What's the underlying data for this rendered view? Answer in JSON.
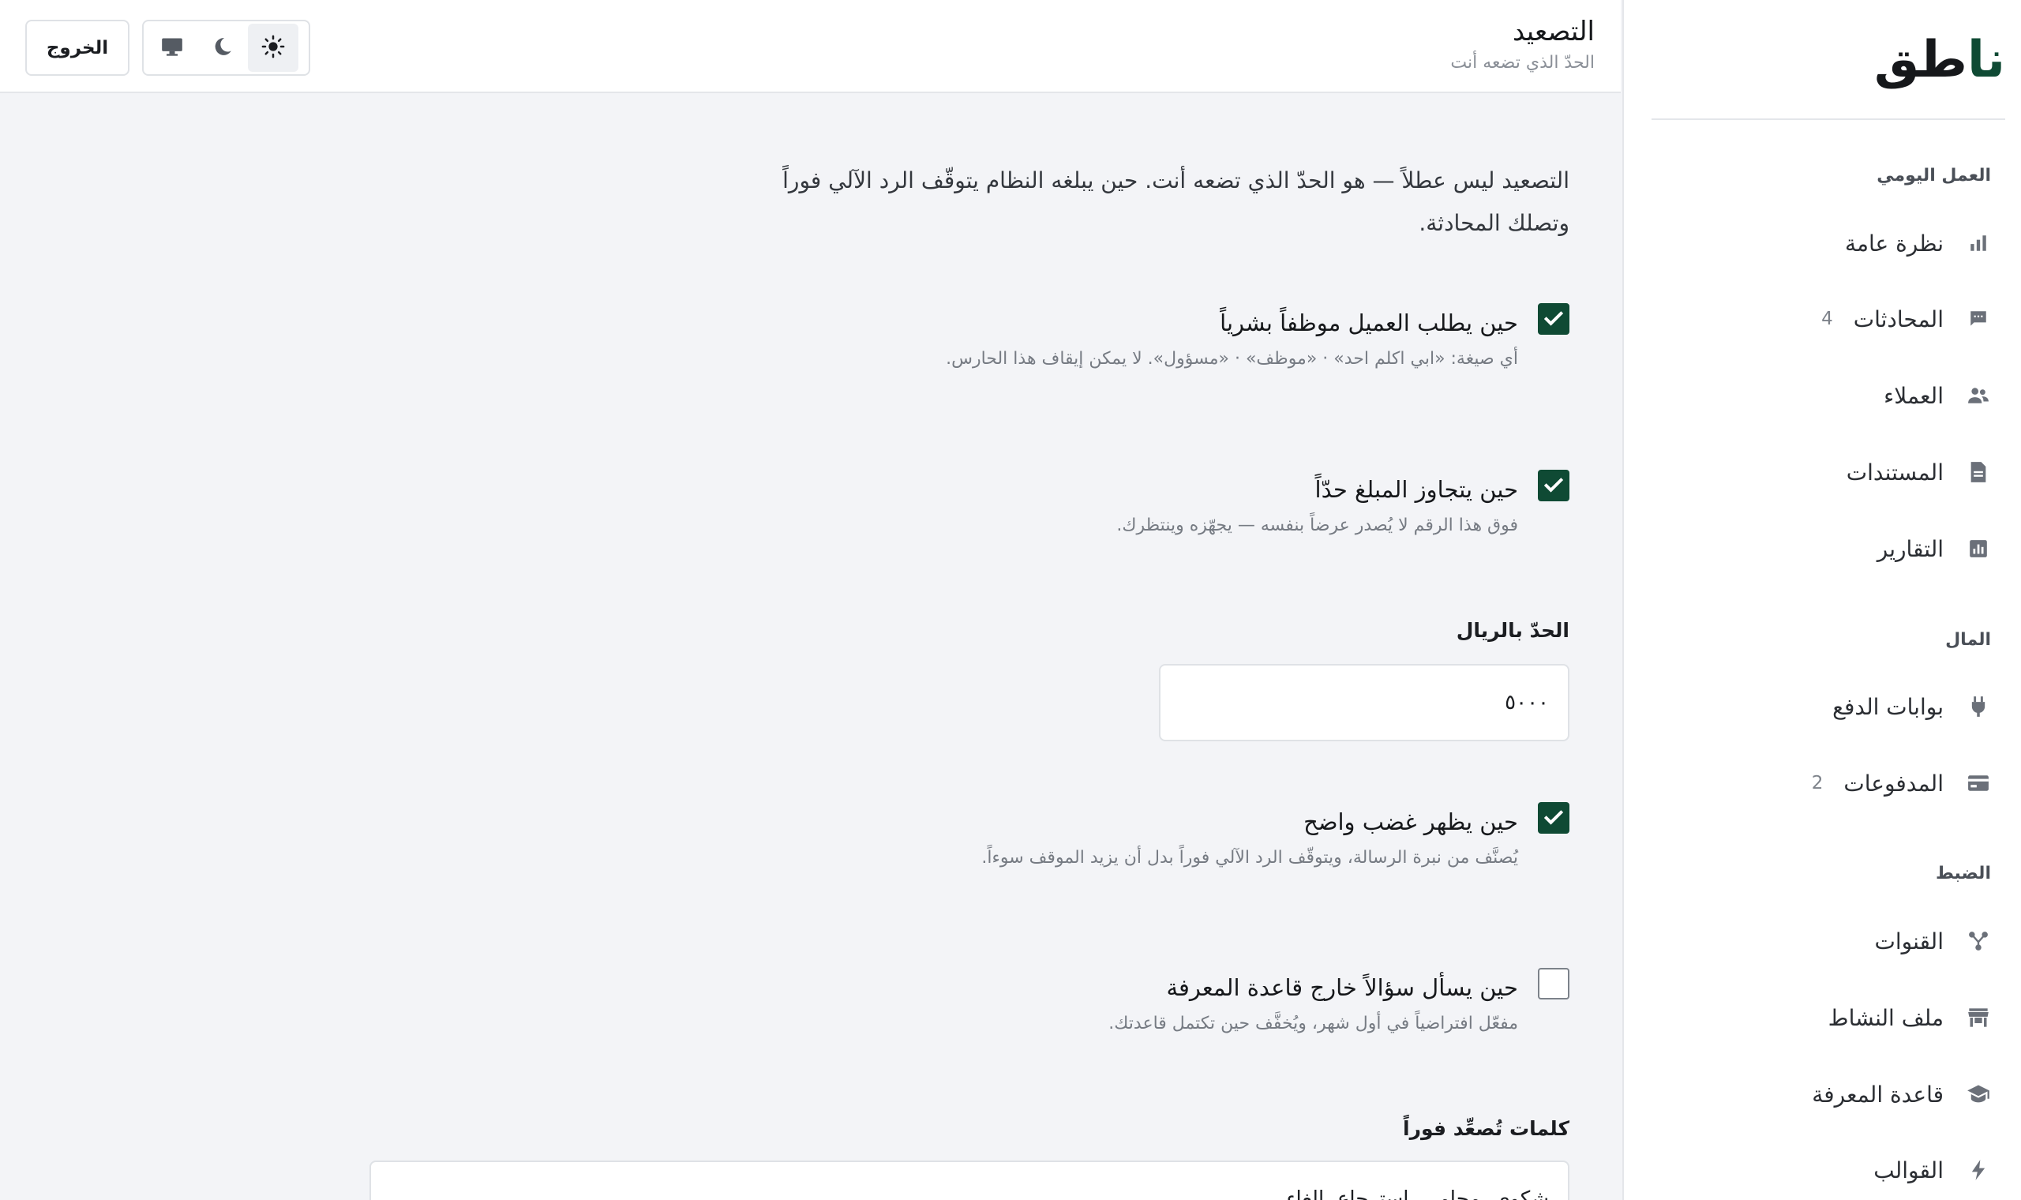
{
  "sidebar": {
    "brand_part1": "نا",
    "brand_part2": "طق",
    "sections": [
      {
        "label": "العمل اليومي"
      },
      {
        "label": "المال"
      },
      {
        "label": "الضبط"
      }
    ],
    "items": [
      {
        "label": "نظرة عامة",
        "icon": "bar-chart-icon",
        "count": ""
      },
      {
        "label": "المحادثات",
        "icon": "chat-icon",
        "count": "4"
      },
      {
        "label": "العملاء",
        "icon": "people-icon",
        "count": ""
      },
      {
        "label": "المستندات",
        "icon": "document-icon",
        "count": ""
      },
      {
        "label": "التقارير",
        "icon": "report-icon",
        "count": ""
      },
      {
        "label": "بوابات الدفع",
        "icon": "plug-icon",
        "count": ""
      },
      {
        "label": "المدفوعات",
        "icon": "credit-card-icon",
        "count": "2"
      },
      {
        "label": "القنوات",
        "icon": "channels-icon",
        "count": ""
      },
      {
        "label": "ملف النشاط",
        "icon": "store-icon",
        "count": ""
      },
      {
        "label": "قاعدة المعرفة",
        "icon": "graduation-cap-icon",
        "count": ""
      },
      {
        "label": "القوالب",
        "icon": "lightning-icon",
        "count": ""
      }
    ]
  },
  "header": {
    "title": "التصعيد",
    "subtitle": "الحدّ الذي تضعه أنت",
    "theme_options": [
      "light-mode-icon",
      "dark-mode-icon",
      "system-mode-icon"
    ],
    "theme_selected": "light",
    "logout_label": "الخروج"
  },
  "main": {
    "intro_line1": "التصعيد ليس عطلاً — هو الحدّ الذي تضعه أنت. حين يبلغه النظام يتوقّف الرد الآلي فوراً",
    "intro_line2": "وتصلك المحادثة.",
    "options": [
      {
        "title": "حين يطلب العميل موظفاً بشرياً",
        "desc": "أي صيغة: «ابي اكلم احد» · «موظف» · «مسؤول». لا يمكن إيقاف هذا الحارس.",
        "checked": true
      },
      {
        "title": "حين يتجاوز المبلغ حدّاً",
        "desc": "فوق هذا الرقم لا يُصدر عرضاً بنفسه — يجهّزه وينتظرك.",
        "checked": true
      },
      {
        "title": "حين يظهر غضب واضح",
        "desc": "يُصنَّف من نبرة الرسالة، ويتوقّف الرد الآلي فوراً بدل أن يزيد الموقف سوءاً.",
        "checked": true
      },
      {
        "title": "حين يسأل سؤالاً خارج قاعدة المعرفة",
        "desc": "مفعّل افتراضياً في أول شهر، ويُخفَّف حين تكتمل قاعدتك.",
        "checked": false
      }
    ],
    "threshold_label": "الحدّ بالريال",
    "threshold_value": "٥٠٠٠",
    "keywords_label": "كلمات تُصعِّد فوراً",
    "keywords_value": "شكوى، محامي، استرجاع، إلغاء"
  }
}
